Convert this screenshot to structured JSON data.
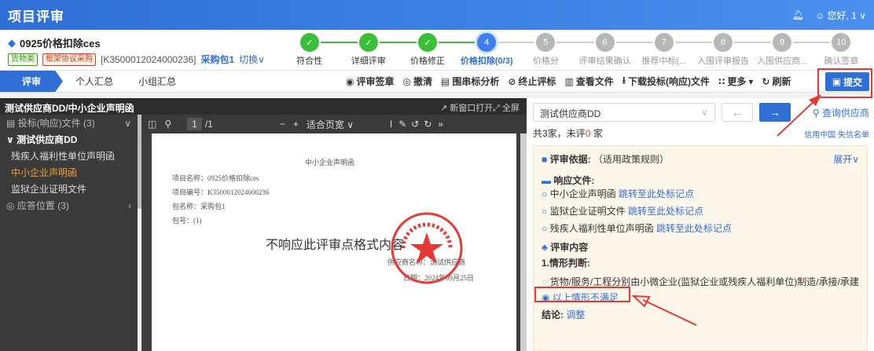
{
  "topbar": {
    "title": "项目评审",
    "user": "您好, 1"
  },
  "header": {
    "project_title": "0925价格扣除ces",
    "tag_goods": "货物类",
    "tag_frame": "框架协议采购",
    "project_code": "[K3500012024000236]",
    "package": "采购包1",
    "switch": "切换"
  },
  "steps": [
    {
      "num": "✓",
      "label": "符合性",
      "state": "done"
    },
    {
      "num": "✓",
      "label": "详细评审",
      "state": "done"
    },
    {
      "num": "✓",
      "label": "价格修正",
      "state": "done"
    },
    {
      "num": "4",
      "label": "价格扣除(0/3)",
      "state": "cur"
    },
    {
      "num": "5",
      "label": "价格分",
      "state": "todo"
    },
    {
      "num": "6",
      "label": "评审结果确认",
      "state": "todo"
    },
    {
      "num": "7",
      "label": "推荐中标(...",
      "state": "todo"
    },
    {
      "num": "8",
      "label": "入围评审报告",
      "state": "todo"
    },
    {
      "num": "9",
      "label": "入围供应商...",
      "state": "todo"
    },
    {
      "num": "10",
      "label": "确认签章",
      "state": "todo"
    }
  ],
  "tabs": [
    "评审",
    "个人汇总",
    "小组汇总"
  ],
  "tools": {
    "sign": "评审签章",
    "clear": "撤清",
    "analysis": "围串标分析",
    "terminate": "终止评标",
    "view": "查看文件",
    "download": "下载投标(响应)文件",
    "more": "更多",
    "refresh": "刷新",
    "submit": "提交"
  },
  "left": {
    "header": "测试供应商DD/中小企业声明函",
    "group1": "投标(响应)文件",
    "group1_count": "(3)",
    "supplier": "测试供应商DD",
    "items": [
      "残疾人福利性单位声明函",
      "中小企业声明函",
      "监狱企业证明文件"
    ],
    "group2": "应答位置",
    "group2_count": "(3)"
  },
  "viewer": {
    "open_new": "新窗口打开",
    "fullscreen": "全屏",
    "page": "1",
    "pages": "/1",
    "zoom": "适合页宽",
    "doc_title": "中小企业声明函",
    "doc_lines": [
      "项目名称：0925价格扣除ces",
      "项目编号：K3500012024000236",
      "包名称：采购包1",
      "包号：(1)"
    ],
    "big_text": "不响应此评审点格式内容",
    "supplier_line": "供应商名称：测试供应商",
    "date_line": "日期：2024年09月25日"
  },
  "right": {
    "supplier_select": "测试供应商DD",
    "query": "查询供应商",
    "summary_prefix": "共3家，未评",
    "summary_count": "0",
    "summary_suffix": "家",
    "credit1": "信用中国",
    "credit2": "失信名单",
    "basis_label": "评审依据:",
    "basis_value": "（适用政策规则）",
    "expand": "展开",
    "response_label": "响应文件:",
    "files": [
      {
        "name": "中小企业声明函",
        "link": "跳转至此处标记点"
      },
      {
        "name": "监狱企业证明文件",
        "link": "跳转至此处标记点"
      },
      {
        "name": "残疾人福利性单位声明函",
        "link": "跳转至此处标记点"
      }
    ],
    "content_label": "评审内容",
    "judge_label": "1.情形判断:",
    "option1": "货物/服务/工程分别由小微企业(监狱企业或残疾人福利单位)制造/承接/承建",
    "option2": "以上情形不满足",
    "conclusion_label": "结论:",
    "adjust": "调整"
  },
  "colors": {
    "primary": "#2f6fd6",
    "done": "#3bbf3b",
    "annotation": "#e53935"
  }
}
